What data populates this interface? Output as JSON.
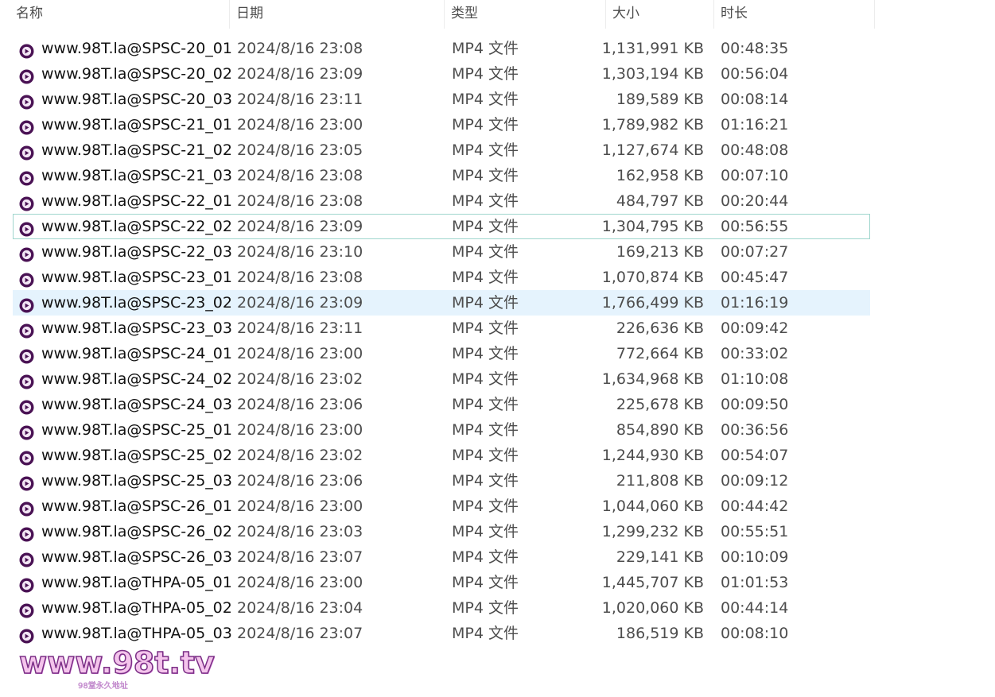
{
  "columns": {
    "name": "名称",
    "date": "日期",
    "type": "类型",
    "size": "大小",
    "duration": "时长",
    "sort_indicator": "^"
  },
  "files": [
    {
      "name": "www.98T.la@SPSC-20_01",
      "date": "2024/8/16 23:08",
      "type": "MP4 文件",
      "size": "1,131,991 KB",
      "duration": "00:48:35"
    },
    {
      "name": "www.98T.la@SPSC-20_02",
      "date": "2024/8/16 23:09",
      "type": "MP4 文件",
      "size": "1,303,194 KB",
      "duration": "00:56:04"
    },
    {
      "name": "www.98T.la@SPSC-20_03",
      "date": "2024/8/16 23:11",
      "type": "MP4 文件",
      "size": "189,589 KB",
      "duration": "00:08:14"
    },
    {
      "name": "www.98T.la@SPSC-21_01",
      "date": "2024/8/16 23:00",
      "type": "MP4 文件",
      "size": "1,789,982 KB",
      "duration": "01:16:21"
    },
    {
      "name": "www.98T.la@SPSC-21_02",
      "date": "2024/8/16 23:05",
      "type": "MP4 文件",
      "size": "1,127,674 KB",
      "duration": "00:48:08"
    },
    {
      "name": "www.98T.la@SPSC-21_03",
      "date": "2024/8/16 23:08",
      "type": "MP4 文件",
      "size": "162,958 KB",
      "duration": "00:07:10"
    },
    {
      "name": "www.98T.la@SPSC-22_01",
      "date": "2024/8/16 23:08",
      "type": "MP4 文件",
      "size": "484,797 KB",
      "duration": "00:20:44"
    },
    {
      "name": "www.98T.la@SPSC-22_02",
      "date": "2024/8/16 23:09",
      "type": "MP4 文件",
      "size": "1,304,795 KB",
      "duration": "00:56:55",
      "state": "focused"
    },
    {
      "name": "www.98T.la@SPSC-22_03",
      "date": "2024/8/16 23:10",
      "type": "MP4 文件",
      "size": "169,213 KB",
      "duration": "00:07:27"
    },
    {
      "name": "www.98T.la@SPSC-23_01",
      "date": "2024/8/16 23:08",
      "type": "MP4 文件",
      "size": "1,070,874 KB",
      "duration": "00:45:47"
    },
    {
      "name": "www.98T.la@SPSC-23_02",
      "date": "2024/8/16 23:09",
      "type": "MP4 文件",
      "size": "1,766,499 KB",
      "duration": "01:16:19",
      "state": "selected"
    },
    {
      "name": "www.98T.la@SPSC-23_03",
      "date": "2024/8/16 23:11",
      "type": "MP4 文件",
      "size": "226,636 KB",
      "duration": "00:09:42"
    },
    {
      "name": "www.98T.la@SPSC-24_01",
      "date": "2024/8/16 23:00",
      "type": "MP4 文件",
      "size": "772,664 KB",
      "duration": "00:33:02"
    },
    {
      "name": "www.98T.la@SPSC-24_02",
      "date": "2024/8/16 23:02",
      "type": "MP4 文件",
      "size": "1,634,968 KB",
      "duration": "01:10:08"
    },
    {
      "name": "www.98T.la@SPSC-24_03",
      "date": "2024/8/16 23:06",
      "type": "MP4 文件",
      "size": "225,678 KB",
      "duration": "00:09:50"
    },
    {
      "name": "www.98T.la@SPSC-25_01",
      "date": "2024/8/16 23:00",
      "type": "MP4 文件",
      "size": "854,890 KB",
      "duration": "00:36:56"
    },
    {
      "name": "www.98T.la@SPSC-25_02",
      "date": "2024/8/16 23:02",
      "type": "MP4 文件",
      "size": "1,244,930 KB",
      "duration": "00:54:07"
    },
    {
      "name": "www.98T.la@SPSC-25_03",
      "date": "2024/8/16 23:06",
      "type": "MP4 文件",
      "size": "211,808 KB",
      "duration": "00:09:12"
    },
    {
      "name": "www.98T.la@SPSC-26_01",
      "date": "2024/8/16 23:00",
      "type": "MP4 文件",
      "size": "1,044,060 KB",
      "duration": "00:44:42"
    },
    {
      "name": "www.98T.la@SPSC-26_02",
      "date": "2024/8/16 23:03",
      "type": "MP4 文件",
      "size": "1,299,232 KB",
      "duration": "00:55:51"
    },
    {
      "name": "www.98T.la@SPSC-26_03",
      "date": "2024/8/16 23:07",
      "type": "MP4 文件",
      "size": "229,141 KB",
      "duration": "00:10:09"
    },
    {
      "name": "www.98T.la@THPA-05_01",
      "date": "2024/8/16 23:00",
      "type": "MP4 文件",
      "size": "1,445,707 KB",
      "duration": "01:01:53"
    },
    {
      "name": "www.98T.la@THPA-05_02",
      "date": "2024/8/16 23:04",
      "type": "MP4 文件",
      "size": "1,020,060 KB",
      "duration": "00:44:14"
    },
    {
      "name": "www.98T.la@THPA-05_03",
      "date": "2024/8/16 23:07",
      "type": "MP4 文件",
      "size": "186,519 KB",
      "duration": "00:08:10"
    }
  ],
  "file_icon": "media-file-icon",
  "colors": {
    "icon_purple": "#4a1254",
    "selected_row": "#e5f3fd",
    "focus_outline": "#9fd6cd"
  },
  "watermark": {
    "main": "www.98t.tv",
    "sub": "98堂永久地址"
  }
}
